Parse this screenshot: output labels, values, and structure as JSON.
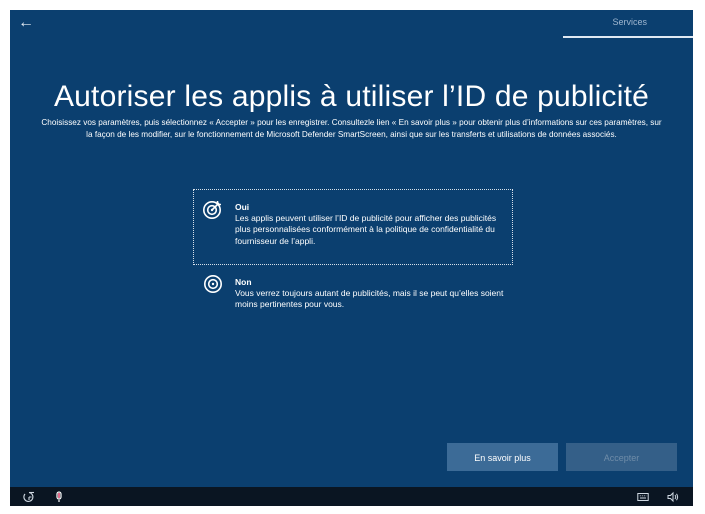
{
  "header": {
    "back_icon": "back-arrow-icon",
    "tab_label": "Services"
  },
  "main": {
    "title": "Autoriser les applis à utiliser l’ID de publicité",
    "description": "Choisissez vos paramètres, puis sélectionnez « Accepter » pour les enregistrer. Consultezle lien « En savoir plus » pour obtenir plus d’informations sur ces paramètres, sur la façon de les modifier, sur le fonctionnement de Microsoft Defender SmartScreen, ainsi que sur les transferts et utilisations de données associés.",
    "options": [
      {
        "title": "Oui",
        "body": "Les applis peuvent utiliser l’ID de publicité pour afficher des publicités plus personnalisées conformément à la politique de confidentialité du fournisseur de l’appli.",
        "icon": "target-check-icon",
        "selected": true
      },
      {
        "title": "Non",
        "body": "Vous verrez toujours autant de publicités, mais il se peut qu’elles soient moins pertinentes pour vous.",
        "icon": "target-icon",
        "selected": false
      }
    ]
  },
  "buttons": {
    "learn_more": "En savoir plus",
    "accept": "Accepter"
  },
  "taskbar": {
    "left_icons": [
      "accessibility-icon",
      "microphone-icon"
    ],
    "right_icons": [
      "keyboard-icon",
      "volume-icon"
    ]
  },
  "colors": {
    "background": "#0b3f6f",
    "button": "#3c6b97",
    "taskbar": "#0a1522"
  }
}
